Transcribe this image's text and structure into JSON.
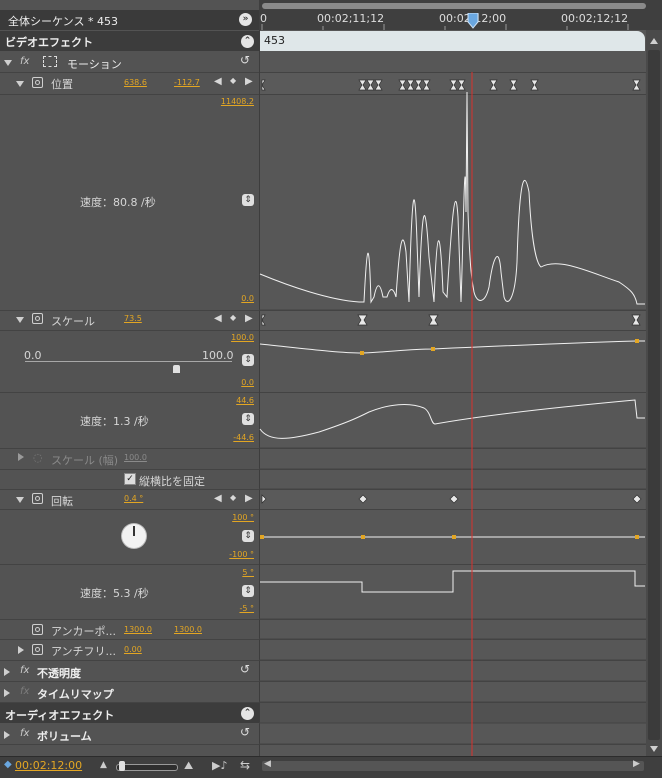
{
  "header": {
    "sequence_title": "全体シーケンス * 453",
    "ruler_ticks": [
      "0",
      "00:02;11;12",
      "00:02;12;00",
      "00:02;12;12"
    ],
    "clip_name": "453"
  },
  "video_effects": {
    "label": "ビデオエフェクト"
  },
  "motion": {
    "label": "モーション",
    "position": {
      "label": "位置",
      "x": "638.6",
      "y": "-112.7",
      "max": "11408.2",
      "min": "0.0",
      "speed_label": "速度：80.8 /秒"
    },
    "scale": {
      "label": "スケール",
      "value": "73.5",
      "range_min": "0.0",
      "range_max": "100.0",
      "graph_max": "100.0",
      "graph_min": "0.0",
      "speed_max": "44.6",
      "speed_min": "-44.6",
      "speed_label": "速度：1.3 /秒"
    },
    "scale_width": {
      "label": "スケール (幅)",
      "value": "100.0"
    },
    "uniform_scale": {
      "label": "縦横比を固定",
      "checked": true
    },
    "rotation": {
      "label": "回転",
      "value": "0.4 °",
      "graph_max": "100 °",
      "graph_min": "-100 °",
      "speed_max": "5 °",
      "speed_min": "-5 °",
      "speed_label": "速度：5.3 /秒"
    },
    "anchor": {
      "label": "アンカーポ...",
      "x": "1300.0",
      "y": "1300.0"
    },
    "antiflicker": {
      "label": "アンチフリ...",
      "value": "0.00"
    }
  },
  "opacity": {
    "label": "不透明度"
  },
  "time_remap": {
    "label": "タイムリマップ"
  },
  "audio_effects": {
    "label": "オーディオエフェクト"
  },
  "volume": {
    "label": "ボリューム"
  },
  "footer": {
    "timecode": "00:02:12:00"
  },
  "colors": {
    "accent": "#e3a623",
    "playhead": "#d9322c",
    "curve": "#f0f0f0"
  }
}
